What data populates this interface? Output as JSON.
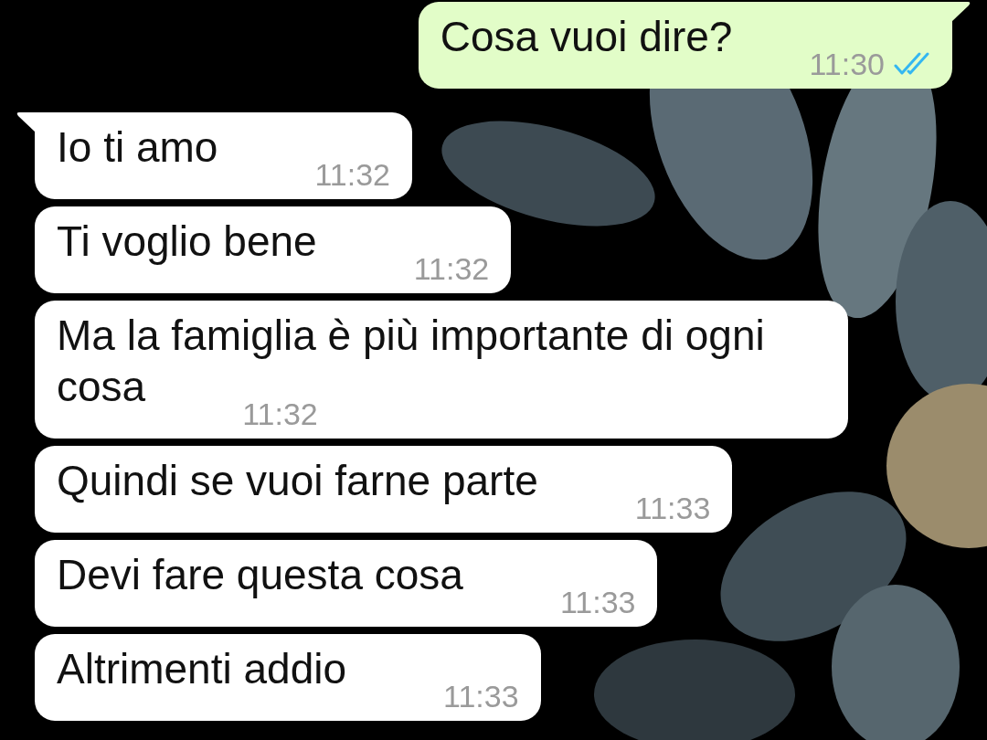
{
  "messages": [
    {
      "kind": "sent",
      "text": "Cosa vuoi dire?",
      "time": "11:30",
      "read": true,
      "tail": true
    },
    {
      "kind": "received",
      "text": "Io ti amo",
      "time": "11:32",
      "tail": true
    },
    {
      "kind": "received",
      "text": "Ti voglio bene",
      "time": "11:32",
      "tail": false
    },
    {
      "kind": "received",
      "text": "Ma la famiglia è più importante di ogni cosa",
      "time": "11:32",
      "tail": false
    },
    {
      "kind": "received",
      "text": "Quindi se vuoi farne parte",
      "time": "11:33",
      "tail": false
    },
    {
      "kind": "received",
      "text": "Devi fare questa cosa",
      "time": "11:33",
      "tail": false
    },
    {
      "kind": "received",
      "text": "Altrimenti addio",
      "time": "11:33",
      "tail": false
    }
  ]
}
